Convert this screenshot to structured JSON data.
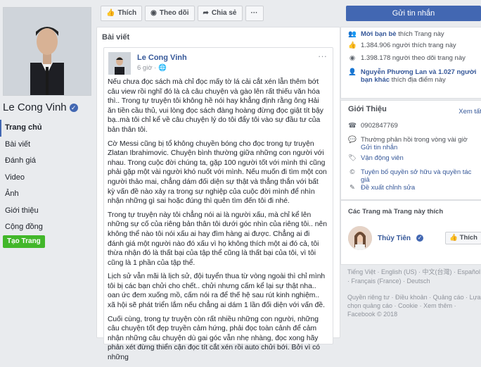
{
  "profile": {
    "name": "Le Cong Vinh",
    "verified_icon": "verified-badge-icon"
  },
  "nav": {
    "items": [
      "Trang chủ",
      "Bài viết",
      "Đánh giá",
      "Video",
      "Ảnh",
      "Giới thiệu",
      "Cộng đồng"
    ],
    "active_index": 0,
    "create_page_label": "Tạo Trang"
  },
  "actions": {
    "like_label": "Thích",
    "follow_label": "Theo dõi",
    "share_label": "Chia sẻ",
    "more_label": "···"
  },
  "feed": {
    "title": "Bài viết",
    "post": {
      "author": "Le Cong Vinh",
      "time": "6 giờ ·",
      "more": "···",
      "paragraphs": [
        "Nếu chưa đọc sách mà chỉ đọc mấy tờ lá cải cắt xén lẫn thêm bớt câu view rồi nghĩ đó là cả câu chuyện và gào lên rất thiếu văn hóa thì.. Trong tự truyện tôi không hề nói hay khẳng định rằng ông Hải ăn tiền cầu thủ, vui lòng đọc sách đàng hoàng đừng đọc giật tít bậy bạ..mà tôi chỉ kể về câu chuyện lý do tôi đẩy tôi vào sự đầu tư của bản thân tôi.",
        "Cờ Messi cũng bị tổ không chuyền bóng cho đọc trong tự truyện Zlatan Ibrahimovic. Chuyện bình thường giữa những con người với nhau. Trong cuộc đời chúng ta, gặp 100 người tốt với mình thì cũng phải gặp một vài người khó nuốt với mình. Nếu muốn đi tìm một con người thảo mai, chẳng dám đối diện sự thật và thẳng thắn với bất kỳ vấn đề nào xảy ra trong sự nghiệp của cuộc đời mình để nhìn nhận những gì sai hoặc đúng thì quên tìm đến tôi đi nhé.",
        "Trong tự truyện này tôi chẳng nói ai là người xấu, mà chỉ kể lên những sự cố của riêng bản thân tôi dưới góc nhìn của riêng tôi.. nên không thể nào tôi nói xấu ai hay đìm hàng ai được. Chẳng ai đi đánh giá một người nào đó xấu vì họ không thích một ai đó cả, tôi thừa nhận đó là thất bại của tập thể cũng là thất bại của tôi, vì tôi cũng là 1 phần của tập thể.",
        "Lịch sử vẫn mãi là lịch sử, đội tuyển thua từ vòng ngoài thì chỉ mình tôi bị các bạn chửi cho chết.. chửi nhưng cấm kể lại sự thật nha.. oan ức đem xuống mồ, cấm nói ra để thế hệ sau rút kinh nghiệm.. xã hội sẽ phát triển lắm nếu chẳng ai dám 1 lần đối diện với vấn đề.",
        "Cuối cùng, trong tự truyện còn rất nhiều những con người, những câu chuyện tốt đẹp truyền cảm hứng, phải đọc toàn cảnh để cảm nhận những câu chuyện dù gai góc vẫn nhẹ nhàng, đọc xong hãy phản xét đừng thiển cận đọc tít cắt xén rồi auto chửi bới. Bởi vì có những"
      ]
    }
  },
  "right": {
    "send_message_label": "Gửi tin nhắn",
    "stats": [
      {
        "icon": "invite-friends-icon",
        "link": "Mời bạn bè",
        "text": " thích Trang này"
      },
      {
        "icon": "like-icon",
        "link": "",
        "text": "1.384.906 người thích trang này"
      },
      {
        "icon": "follow-icon",
        "link": "",
        "text": "1.398.178 người theo dõi trang này"
      },
      {
        "icon": "friends-icon",
        "link": "Nguyễn Phương Lan và 1.027 người bạn khác",
        "text": " thích địa điểm này"
      }
    ],
    "about": {
      "title": "Giới Thiệu",
      "see_all": "Xem tất",
      "rows": [
        {
          "icon": "phone-icon",
          "text": "0902847769",
          "link": ""
        },
        {
          "icon": "message-icon",
          "text": "Thường phản hồi trong vòng vài giờ",
          "link": "Gửi tin nhắn"
        },
        {
          "icon": "category-icon",
          "text": "",
          "link": "Vận động viên"
        },
        {
          "icon": "copyright-icon",
          "text": "",
          "link": "Tuyên bố quyền sở hữu và quyền tác giả"
        },
        {
          "icon": "edit-icon",
          "text": "",
          "link": "Đề xuất chỉnh sửa"
        }
      ]
    },
    "liked_pages": {
      "title": "Các Trang mà Trang này thích",
      "page_name": "Thủy Tiên",
      "like_label": "Thích"
    },
    "languages": "Tiếng Việt · English (US) · 中文(台灣) · Español · Français (France) · Deutsch",
    "footer": "Quyền riêng tư · Điều khoản · Quảng cáo · Lựa chọn quảng cáo · Cookie · Xem thêm · Facebook © 2018"
  }
}
